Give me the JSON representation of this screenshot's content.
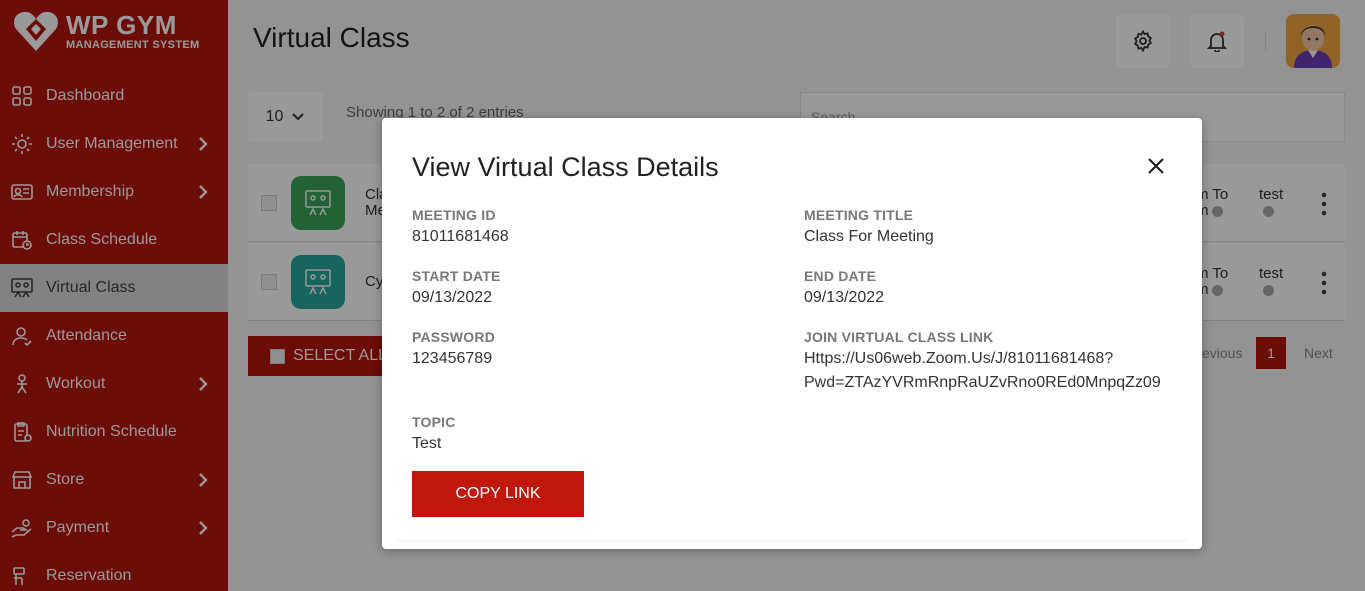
{
  "logo": {
    "title": "WP GYM",
    "subtitle": "MANAGEMENT SYSTEM"
  },
  "sidebar": {
    "items": [
      {
        "label": "Dashboard",
        "icon": "dashboard-icon",
        "has_submenu": false
      },
      {
        "label": "User Management",
        "icon": "users-gear-icon",
        "has_submenu": true
      },
      {
        "label": "Membership",
        "icon": "membership-card-icon",
        "has_submenu": true
      },
      {
        "label": "Class Schedule",
        "icon": "calendar-icon",
        "has_submenu": false
      },
      {
        "label": "Virtual Class",
        "icon": "virtual-class-icon",
        "has_submenu": false,
        "active": true
      },
      {
        "label": "Attendance",
        "icon": "attendance-icon",
        "has_submenu": false
      },
      {
        "label": "Workout",
        "icon": "workout-icon",
        "has_submenu": true
      },
      {
        "label": "Nutrition Schedule",
        "icon": "nutrition-icon",
        "has_submenu": false
      },
      {
        "label": "Store",
        "icon": "store-icon",
        "has_submenu": true
      },
      {
        "label": "Payment",
        "icon": "payment-icon",
        "has_submenu": true
      },
      {
        "label": "Reservation",
        "icon": "reservation-icon",
        "has_submenu": false
      }
    ]
  },
  "header": {
    "title": "Virtual Class",
    "settings_icon": "gear-icon",
    "notification_icon": "bell-icon"
  },
  "table": {
    "length_value": "10",
    "showing_text": "Showing 1 to 2 of 2 entries",
    "search_placeholder": "Search...",
    "rows": [
      {
        "title": "Cla",
        "title2": "Me",
        "col1": "m To",
        "col1b": "m",
        "col2": "test",
        "icon_color": "#3aa35a"
      },
      {
        "title": "Cy",
        "title2": "",
        "col1": "m To",
        "col1b": "m",
        "col2": "test",
        "icon_color": "#29a89d"
      }
    ],
    "select_all_label": "SELECT ALL",
    "pager": {
      "prev": "Previous",
      "current": "1",
      "next": "Next"
    }
  },
  "modal": {
    "title": "View Virtual Class Details",
    "fields": {
      "meeting_id_label": "MEETING ID",
      "meeting_id": "81011681468",
      "meeting_title_label": "MEETING TITLE",
      "meeting_title": "Class For Meeting",
      "start_date_label": "START DATE",
      "start_date": "09/13/2022",
      "end_date_label": "END DATE",
      "end_date": "09/13/2022",
      "password_label": "PASSWORD",
      "password": "123456789",
      "join_link_label": "JOIN VIRTUAL CLASS LINK",
      "join_link_line1": "Https://Us06web.Zoom.Us/J/81011681468?",
      "join_link_line2": "Pwd=ZTAzYVRmRnpRaUZvRno0REd0MnpqZz09",
      "topic_label": "TOPIC",
      "topic": "Test"
    },
    "copy_button": "COPY LINK"
  },
  "colors": {
    "brand": "#b3140c",
    "button": "#c0180d"
  }
}
